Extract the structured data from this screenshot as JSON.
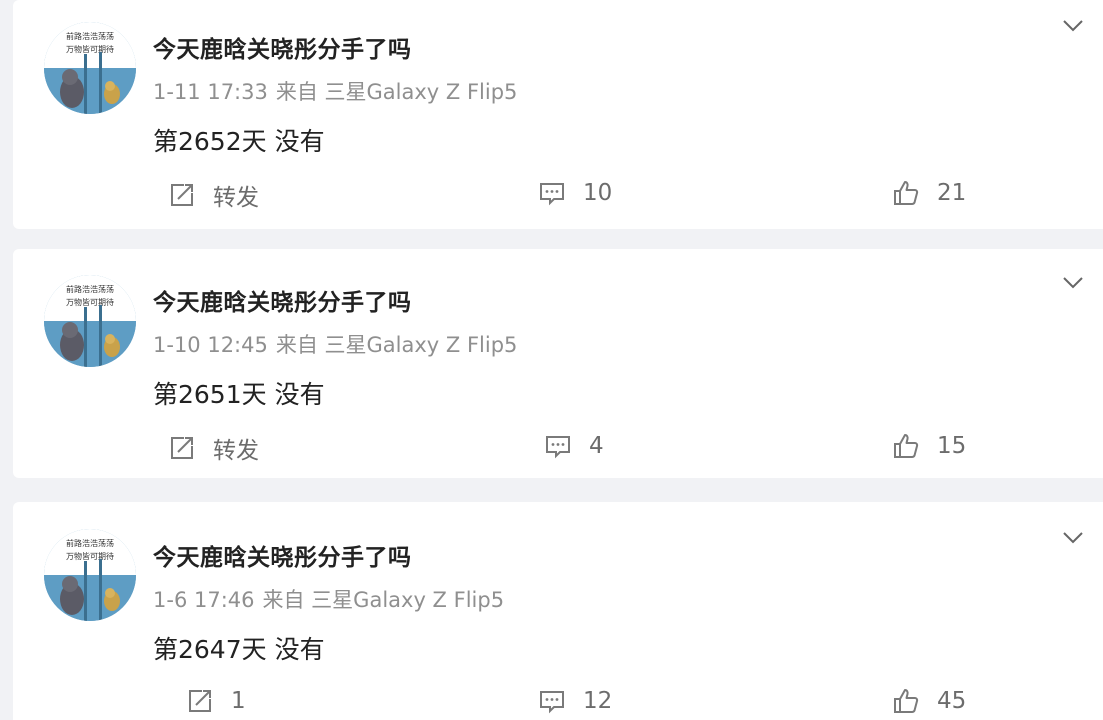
{
  "posts": [
    {
      "author": "今天鹿晗关晓彤分手了吗",
      "avatar_text": [
        "前路浩浩荡荡",
        "万物皆可期待"
      ],
      "time": "1-11 17:33",
      "source": "来自 三星Galaxy Z Flip5",
      "content": "第2652天 没有",
      "repost_label": "转发",
      "comment_count": "10",
      "like_count": "21"
    },
    {
      "author": "今天鹿晗关晓彤分手了吗",
      "avatar_text": [
        "前路浩浩荡荡",
        "万物皆可期待"
      ],
      "time": "1-10 12:45",
      "source": "来自 三星Galaxy Z Flip5",
      "content": "第2651天 没有",
      "repost_label": "转发",
      "comment_count": "4",
      "like_count": "15"
    },
    {
      "author": "今天鹿晗关晓彤分手了吗",
      "avatar_text": [
        "前路浩浩荡荡",
        "万物皆可期待"
      ],
      "time": "1-6 17:46",
      "source": "来自 三星Galaxy Z Flip5",
      "content": "第2647天 没有",
      "repost_label": "1",
      "comment_count": "12",
      "like_count": "45"
    }
  ],
  "icons": {
    "expand": "chevron-down-icon",
    "repost": "repost-icon",
    "comment": "comment-icon",
    "like": "thumbs-up-icon"
  },
  "colors": {
    "page_bg": "#f1f2f5",
    "card_bg": "#ffffff",
    "author": "#222222",
    "meta": "#8f8f8f",
    "action": "#6c6c6c"
  }
}
